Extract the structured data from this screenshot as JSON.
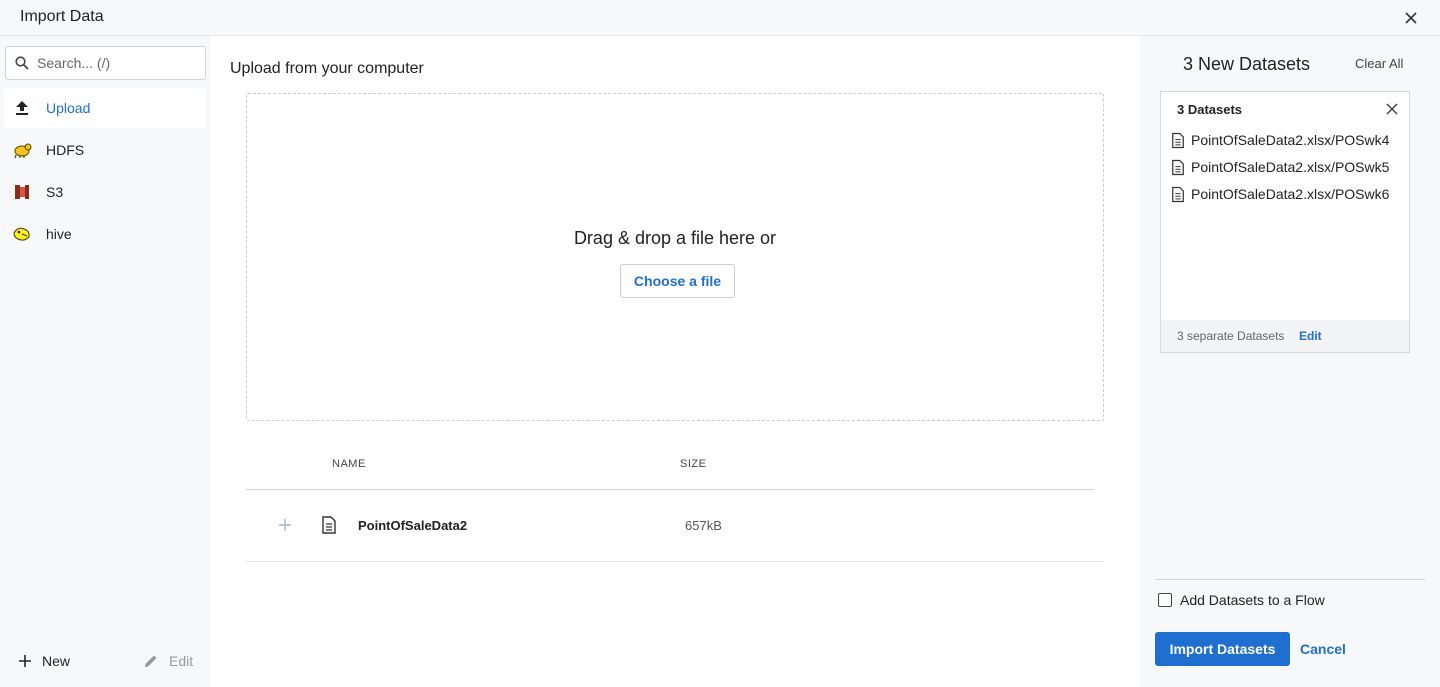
{
  "window": {
    "title": "Import Data"
  },
  "sidebar": {
    "search_placeholder": "Search... (/)",
    "items": [
      {
        "label": "Upload",
        "icon": "upload-icon"
      },
      {
        "label": "HDFS",
        "icon": "hdfs-icon"
      },
      {
        "label": "S3",
        "icon": "s3-icon"
      },
      {
        "label": "hive",
        "icon": "hive-icon"
      }
    ],
    "footer": {
      "new_label": "New",
      "edit_label": "Edit"
    }
  },
  "main": {
    "title": "Upload from your computer",
    "dropzone": {
      "text": "Drag & drop a file here or",
      "button_label": "Choose a file"
    },
    "table": {
      "headers": [
        "NAME",
        "SIZE"
      ],
      "rows": [
        {
          "name": "PointOfSaleData2",
          "size": "657kB"
        }
      ]
    }
  },
  "right_panel": {
    "title": "3 New Datasets",
    "clear_all_label": "Clear All",
    "card": {
      "title": "3 Datasets",
      "datasets": [
        "PointOfSaleData2.xlsx/POSwk4",
        "PointOfSaleData2.xlsx/POSwk5",
        "PointOfSaleData2.xlsx/POSwk6"
      ],
      "footer_text": "3 separate Datasets",
      "footer_edit_label": "Edit"
    },
    "add_to_flow_label": "Add Datasets to a Flow",
    "add_to_flow_checked": false,
    "import_label": "Import Datasets",
    "cancel_label": "Cancel"
  },
  "colors": {
    "accent": "#1f6fd1",
    "panel_bg": "#f7f8fa"
  }
}
